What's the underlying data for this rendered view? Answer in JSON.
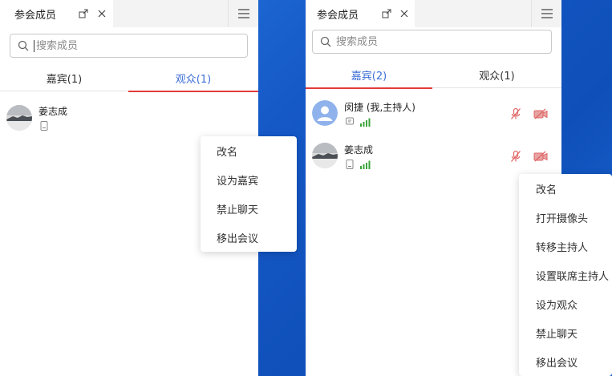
{
  "left_panel": {
    "title": "参会成员",
    "search_placeholder": "搜索成员",
    "tabs": {
      "guests": "嘉宾(1)",
      "audience": "观众(1)"
    },
    "members": [
      {
        "name": "姜志成"
      }
    ],
    "context_menu": [
      "改名",
      "设为嘉宾",
      "禁止聊天",
      "移出会议"
    ]
  },
  "right_panel": {
    "title": "参会成员",
    "search_placeholder": "搜索成员",
    "tabs": {
      "guests": "嘉宾(2)",
      "audience": "观众(1)"
    },
    "members": [
      {
        "name": "闵捷 (我,主持人)"
      },
      {
        "name": "姜志成"
      }
    ],
    "context_menu": [
      "改名",
      "打开摄像头",
      "转移主持人",
      "设置联席主持人",
      "设为观众",
      "禁止聊天",
      "移出会议"
    ]
  },
  "icons": {
    "popout": "popout-icon",
    "close": "close-icon",
    "menu": "menu-icon",
    "search": "search-icon",
    "device": "phone-device-icon",
    "signal": "signal-icon",
    "mic_off": "mic-off-icon",
    "camera_off": "camera-off-icon"
  },
  "colors": {
    "accent_blue": "#3e6fd6",
    "tab_underline": "#e23b3b",
    "signal_green": "#3aa53a",
    "muted_red": "#e06666",
    "avatar_blue": "#8fb2ec"
  }
}
